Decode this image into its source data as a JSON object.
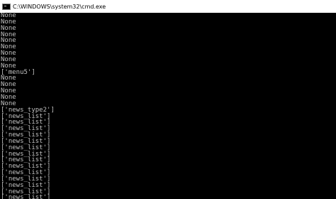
{
  "window": {
    "title": "C:\\WINDOWS\\system32\\cmd.exe",
    "icon": "cmd-icon"
  },
  "console": {
    "lines": [
      "None",
      "None",
      "None",
      "None",
      "None",
      "None",
      "None",
      "None",
      "None",
      "['menu5']",
      "None",
      "None",
      "None",
      "None",
      "None",
      "['news_type2']",
      "['news_list']",
      "['news_list']",
      "['news_list']",
      "['news_list']",
      "['news_list']",
      "['news_list']",
      "['news_list']",
      "['news_list']",
      "['news_list']",
      "['news_list']",
      "['news_list']",
      "['news_list']",
      "['news_list']",
      "['news_list']"
    ]
  },
  "colors": {
    "background": "#000000",
    "text": "#c0c0c0",
    "titlebar": "#ffffff"
  }
}
